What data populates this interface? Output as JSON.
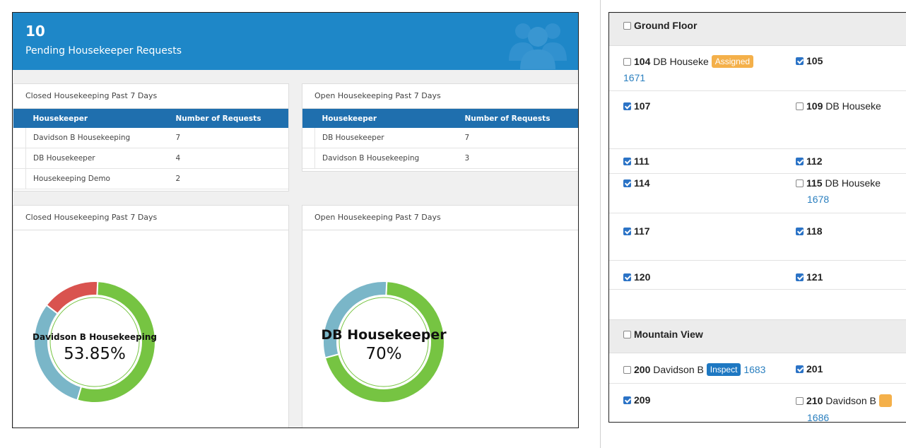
{
  "banner": {
    "count": "10",
    "subtitle": "Pending Housekeeper Requests"
  },
  "tables": [
    {
      "title": "Closed Housekeeping Past 7 Days",
      "columns": [
        "Housekeeper",
        "Number of Requests"
      ],
      "rows": [
        [
          "Davidson B Housekeeping",
          "7"
        ],
        [
          "DB Housekeeper",
          "4"
        ],
        [
          "Housekeeping Demo",
          "2"
        ]
      ]
    },
    {
      "title": "Open Housekeeping Past 7 Days",
      "columns": [
        "Housekeeper",
        "Number of Requests"
      ],
      "rows": [
        [
          "DB Housekeeper",
          "7"
        ],
        [
          "Davidson B Housekeeping",
          "3"
        ]
      ]
    }
  ],
  "charts": [
    {
      "title": "Closed Housekeeping Past 7 Days",
      "center_name": "Davidson B Housekeeping",
      "center_pct": "53.85%"
    },
    {
      "title": "Open Housekeeping Past 7 Days",
      "center_name": "DB Housekeeper",
      "center_pct": "70%"
    }
  ],
  "chart_data": [
    {
      "type": "pie",
      "title": "Closed Housekeeping Past 7 Days",
      "categories": [
        "Davidson B Housekeeping",
        "DB Housekeeper",
        "Housekeeping Demo"
      ],
      "values": [
        7,
        4,
        2
      ],
      "colors": [
        "#76c442",
        "#7ab6c8",
        "#d9534f"
      ]
    },
    {
      "type": "pie",
      "title": "Open Housekeeping Past 7 Days",
      "categories": [
        "DB Housekeeper",
        "Davidson B Housekeeping"
      ],
      "values": [
        7,
        3
      ],
      "colors": [
        "#76c442",
        "#7ab6c8"
      ]
    }
  ],
  "floors": [
    {
      "name": "Ground Floor",
      "rooms": [
        {
          "number": "104",
          "who": "DB Houseke",
          "tag": "Assigned",
          "ref": "1671",
          "checked": false
        },
        {
          "number": "105",
          "checked": true
        },
        {
          "number": "107",
          "checked": true
        },
        {
          "number": "109",
          "who": "DB Houseke",
          "checked": false
        },
        {
          "number": "111",
          "checked": true
        },
        {
          "number": "112",
          "checked": true
        },
        {
          "number": "114",
          "checked": true
        },
        {
          "number": "115",
          "who": "DB Houseke",
          "ref": "1678",
          "checked": false
        },
        {
          "number": "117",
          "checked": true
        },
        {
          "number": "118",
          "checked": true
        },
        {
          "number": "120",
          "checked": true
        },
        {
          "number": "121",
          "checked": true
        }
      ]
    },
    {
      "name": "Mountain View",
      "rooms": [
        {
          "number": "200",
          "who": "Davidson B",
          "tag": "Inspect",
          "ref": "1683",
          "checked": false
        },
        {
          "number": "201",
          "checked": true
        },
        {
          "number": "209",
          "checked": true
        },
        {
          "number": "210",
          "who": "Davidson B",
          "ref": "1686",
          "checked": false
        }
      ]
    }
  ],
  "colors": {
    "banner": "#1e87c8",
    "table_header": "#1f6fae",
    "green": "#76c442",
    "teal": "#7ab6c8",
    "red": "#d9534f",
    "assigned": "#f4b04a",
    "inspect": "#1e78c2"
  }
}
